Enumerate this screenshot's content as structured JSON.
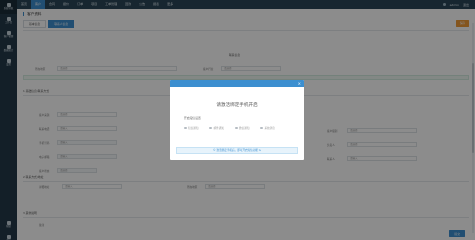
{
  "sidebar": {
    "items": [
      {
        "label": "系统导航",
        "icon": "home-icon"
      },
      {
        "label": "工作台",
        "icon": "desktop-icon"
      },
      {
        "label": "客户管理",
        "icon": "users-icon"
      },
      {
        "label": "数据统计",
        "icon": "chart-icon"
      },
      {
        "label": "设置",
        "icon": "gear-icon"
      }
    ],
    "bottom_items": [
      {
        "label": "帮助",
        "icon": "help-icon"
      },
      {
        "label": "退出",
        "icon": "logout-icon"
      }
    ]
  },
  "topnav": {
    "items": [
      "首页",
      "客户",
      "合同",
      "报价",
      "订单",
      "项目",
      "工单管理",
      "回款",
      "公告",
      "报表",
      "更多"
    ],
    "active_index": 1,
    "user_label": "admin",
    "logout_label": "退出"
  },
  "page": {
    "title": "客户资料",
    "tabs": [
      "基本信息",
      "联系人信息"
    ],
    "active_tab": 1,
    "top_button": "保存",
    "sections": {
      "header_center": "联系信息",
      "s1": "1 基础信息/联系方式",
      "s2": "2 联系方式/地址",
      "s3": "3 其他说明"
    },
    "fields": {
      "region": "所在地区",
      "industry": "客户行业",
      "phone": "联系电话",
      "mobile": "手机号码",
      "email": "电子邮箱",
      "address": "详细地址",
      "contact": "联系人",
      "remark": "备注",
      "source": "客户来源",
      "level": "客户级别",
      "status": "客户状态",
      "owner": "负责人"
    },
    "placeholders": {
      "select": "请选择",
      "input": "请输入"
    },
    "bottom_button": "提交"
  },
  "modal": {
    "title": "请激活绑定手机开启",
    "subtitle": "开启短信设置",
    "options": [
      "短信通知",
      "邮件通知",
      "微信通知",
      "系统消息"
    ],
    "notice": "© 激活绑定手机后，即可开启短信功能 ⇆"
  },
  "colors": {
    "primary": "#3c8fd0",
    "warning": "#f19b38",
    "sidebar": "#243a4a",
    "topnav": "#2a4658"
  }
}
